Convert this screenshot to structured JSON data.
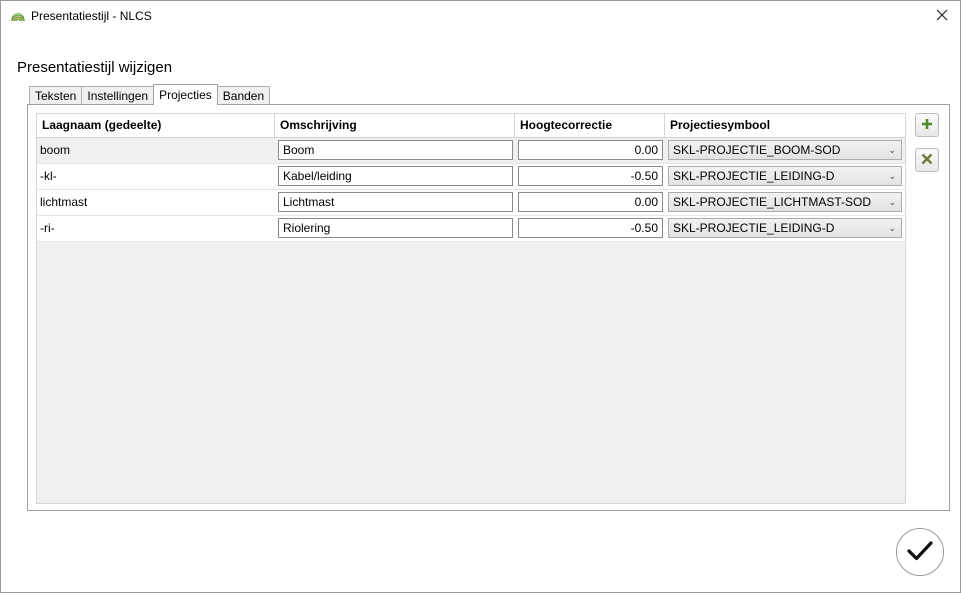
{
  "window": {
    "title": "Presentatiestijl - NLCS"
  },
  "heading": "Presentatiestijl wijzigen",
  "tabs": [
    {
      "label": "Teksten",
      "active": false
    },
    {
      "label": "Instellingen",
      "active": false
    },
    {
      "label": "Projecties",
      "active": true
    },
    {
      "label": "Banden",
      "active": false
    }
  ],
  "grid": {
    "columns": [
      "Laagnaam (gedeelte)",
      "Omschrijving",
      "Hoogtecorrectie",
      "Projectiesymbool"
    ],
    "rows": [
      {
        "layer": "boom",
        "description": "Boom",
        "height": "0.00",
        "symbol": "SKL-PROJECTIE_BOOM-SOD",
        "selected": true
      },
      {
        "layer": "-kl-",
        "description": "Kabel/leiding",
        "height": "-0.50",
        "symbol": "SKL-PROJECTIE_LEIDING-D",
        "selected": false
      },
      {
        "layer": "lichtmast",
        "description": "Lichtmast",
        "height": "0.00",
        "symbol": "SKL-PROJECTIE_LICHTMAST-SOD",
        "selected": false
      },
      {
        "layer": "-ri-",
        "description": "Riolering",
        "height": "-0.50",
        "symbol": "SKL-PROJECTIE_LEIDING-D",
        "selected": false
      }
    ]
  },
  "icons": {
    "add": "plus-icon",
    "remove": "x-icon",
    "confirm": "check-icon",
    "close": "close-icon",
    "app": "nlcs-app-icon"
  },
  "colors": {
    "add_icon": "#4f8a2b",
    "remove_icon": "#6b7a3a",
    "grid_bg": "#f0f0f0"
  }
}
